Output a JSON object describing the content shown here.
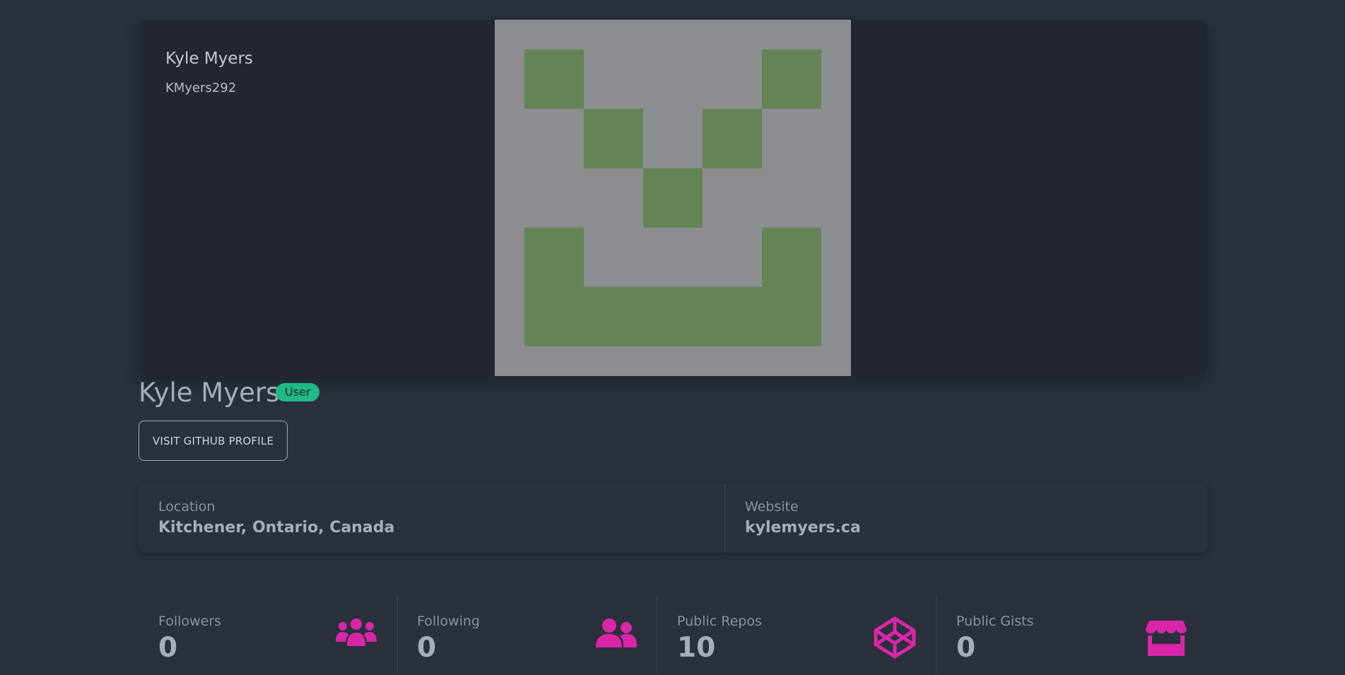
{
  "hero": {
    "name": "Kyle Myers",
    "login": "KMyers292"
  },
  "profile": {
    "name": "Kyle Myers",
    "type_badge": "User",
    "github_button": "VISIT GITHUB PROFILE"
  },
  "info": {
    "location_label": "Location",
    "location_value": "Kitchener, Ontario, Canada",
    "website_label": "Website",
    "website_value": "kylemyers.ca"
  },
  "stats": [
    {
      "label": "Followers",
      "value": "0",
      "icon": "users-icon"
    },
    {
      "label": "Following",
      "value": "0",
      "icon": "user-friends-icon"
    },
    {
      "label": "Public Repos",
      "value": "10",
      "icon": "codepen-icon"
    },
    {
      "label": "Public Gists",
      "value": "0",
      "icon": "store-icon"
    }
  ],
  "colors": {
    "background": "#2a303c",
    "card": "#232730",
    "accent": "#d926a9",
    "badge": "#1fb987",
    "avatar_bg": "#8c8d91",
    "avatar_fg": "#648455"
  }
}
